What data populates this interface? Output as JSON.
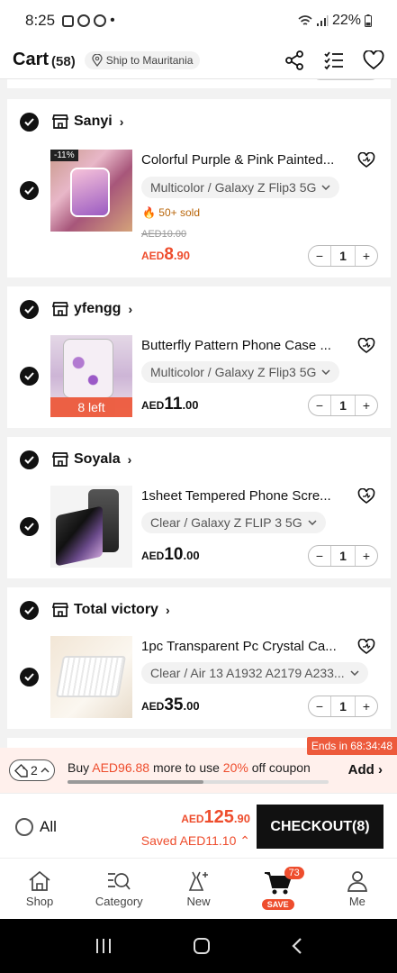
{
  "status_bar": {
    "time": "8:25",
    "dot": "•",
    "battery": "22%"
  },
  "header": {
    "title": "Cart",
    "count": "(58)",
    "ship_to": "Ship to Mauritania"
  },
  "stores": [
    {
      "name": "Sanyi",
      "item": {
        "name": "Colorful Purple & Pink Painted...",
        "variant": "Multicolor / Galaxy Z Flip3 5G",
        "badge": "-11%",
        "sold": "50+ sold",
        "original_price": "AED10.00",
        "price_currency": "AED",
        "price_int": "8",
        "price_dec": ".90",
        "qty": "1"
      }
    },
    {
      "name": "yfengg",
      "item": {
        "name": "Butterfly Pattern Phone Case ...",
        "variant": "Multicolor / Galaxy Z Flip3 5G",
        "stock_badge": "8 left",
        "price_currency": "AED",
        "price_int": "11",
        "price_dec": ".00",
        "qty": "1"
      }
    },
    {
      "name": "Soyala",
      "item": {
        "name": "1sheet Tempered Phone Scre...",
        "variant": "Clear / Galaxy Z FLIP 3 5G",
        "price_currency": "AED",
        "price_int": "10",
        "price_dec": ".00",
        "qty": "1"
      }
    },
    {
      "name": "Total victory",
      "item": {
        "name": "1pc Transparent Pc Crystal Ca...",
        "variant": "Clear / Air 13 A1932 A2179 A233...",
        "price_currency": "AED",
        "price_int": "35",
        "price_dec": ".00",
        "qty": "1"
      }
    }
  ],
  "coupon": {
    "ends_in": "Ends in 68:34:48",
    "pill_count": "2",
    "text_prefix": "Buy ",
    "amount": "AED96.88",
    "text_middle": " more to use ",
    "percent": "20%",
    "text_suffix": " off coupon",
    "add_label": "Add",
    "progress": 0.52
  },
  "checkout": {
    "all_label": "All",
    "total_currency": "AED",
    "total_int": "125",
    "total_dec": ".90",
    "saved": "Saved AED11.10",
    "button": "CHECKOUT(8)"
  },
  "tabs": [
    {
      "label": "Shop",
      "icon": "home-icon"
    },
    {
      "label": "Category",
      "icon": "category-search-icon"
    },
    {
      "label": "New",
      "icon": "new-dress-icon"
    },
    {
      "label": "",
      "icon": "cart-icon",
      "badge": "73",
      "save": "SAVE"
    },
    {
      "label": "Me",
      "icon": "person-icon"
    }
  ],
  "colors": {
    "accent": "#ee4d2d",
    "stock_badge": "#ed5a3c",
    "checkout_button": "#111111",
    "coupon_bg": "#fff0ec"
  }
}
